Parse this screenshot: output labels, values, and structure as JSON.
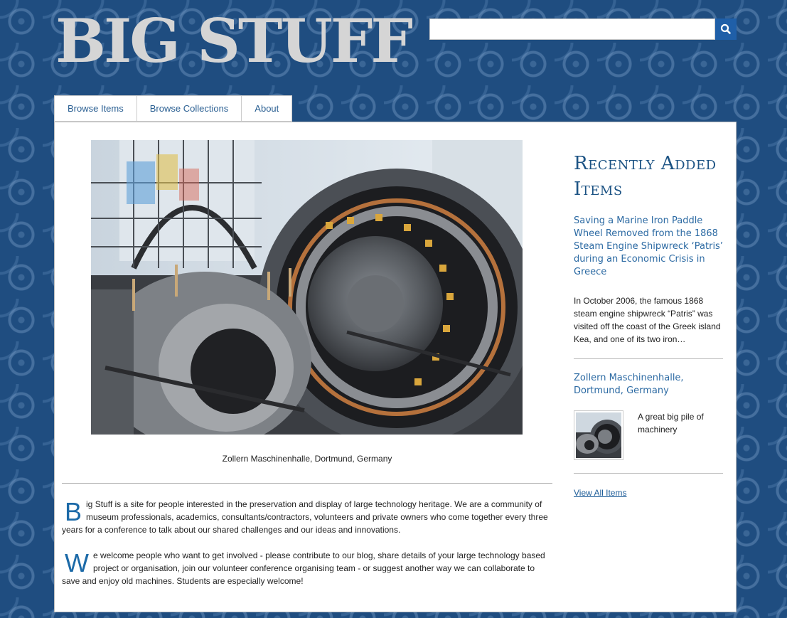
{
  "site": {
    "title": "BIG STUFF"
  },
  "search": {
    "placeholder": "",
    "value": ""
  },
  "nav": {
    "items": [
      "Browse Items",
      "Browse Collections",
      "About"
    ]
  },
  "feature": {
    "caption": "Zollern Maschinenhalle, Dortmund, Germany"
  },
  "intro": {
    "p1": {
      "drop": "B",
      "text": "ig Stuff is a site for people interested in the preservation and display of large technology heritage. We are a community of museum professionals, academics, consultants/contractors, volunteers and private owners who come together every three years for a conference to talk about our shared challenges and our ideas and innovations."
    },
    "p2": {
      "drop": "W",
      "text": "e welcome people who want to get involved - please contribute to our blog, share details of your large technology based project or organisation, join our volunteer conference organising team - or suggest another way we can collaborate to save and enjoy old machines. Students are especially welcome!"
    }
  },
  "sidebar": {
    "heading": "Recently Added Items",
    "items": [
      {
        "title": "Saving a Marine Iron Paddle Wheel Removed from the 1868 Steam Engine Shipwreck ‘Patris’ during an Economic Crisis in Greece",
        "desc": "In October 2006, the famous 1868 steam engine shipwreck “Patris” was visited off the coast of the Greek island Kea, and one of its two iron…"
      },
      {
        "title": "Zollern Maschinenhalle, Dortmund, Germany",
        "desc": "A great big pile of machinery"
      }
    ],
    "view_all": "View All Items"
  },
  "colors": {
    "accent": "#1c5384",
    "link": "#2c6aa3",
    "search_button": "#1f5fa8",
    "background": "#1f4d80"
  },
  "icons": {
    "search_button": "search-icon"
  }
}
